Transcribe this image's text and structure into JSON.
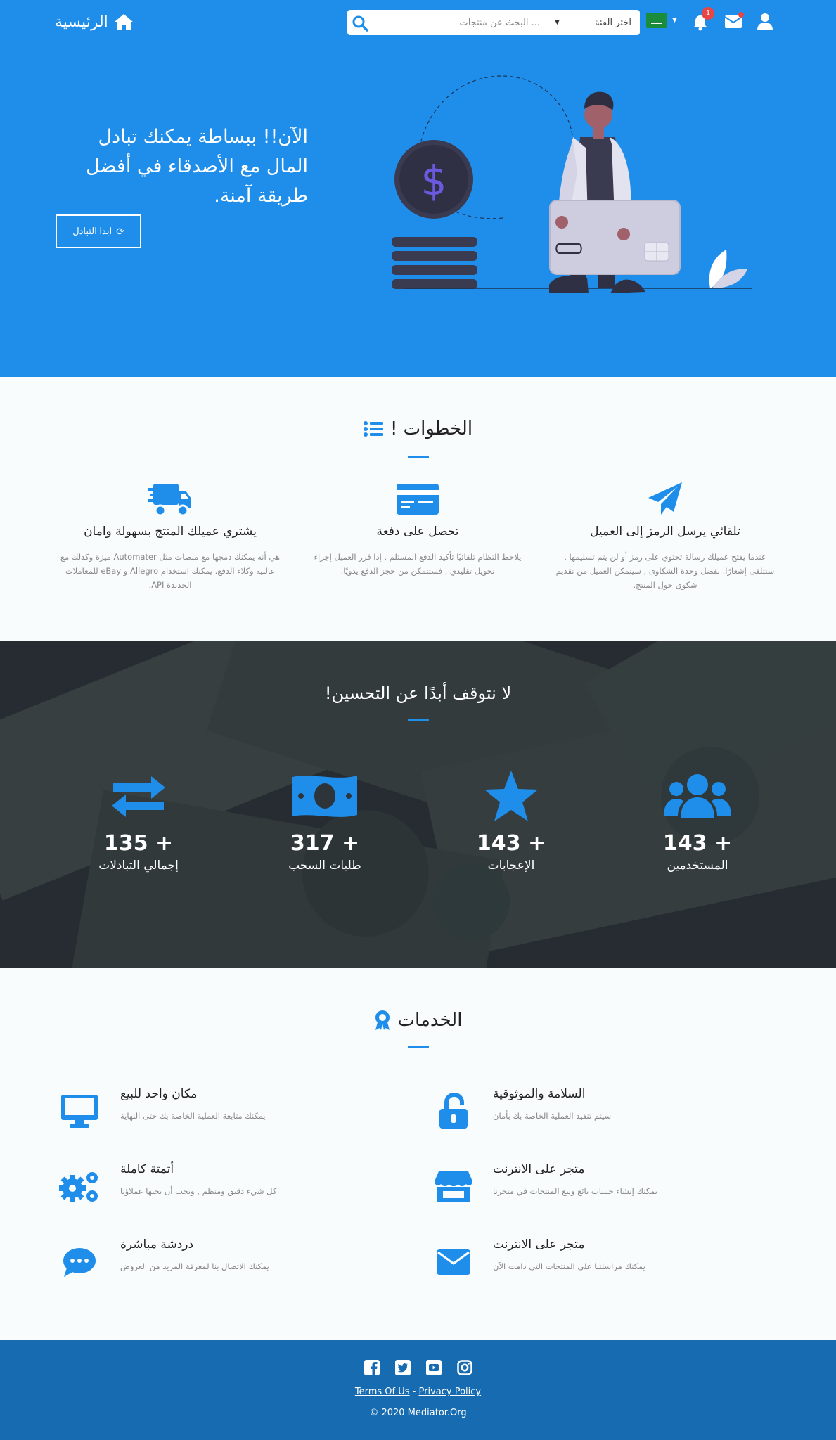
{
  "navbar": {
    "brand": "الرئيسية",
    "search_placeholder": "... البحث عن منتجات",
    "category_label": "اختر الفئة",
    "notification_count": "1"
  },
  "hero": {
    "title": "الآن!! ببساطة يمكنك تبادل المال مع الأصدقاء في أفضل طريقة آمنة.",
    "button_label": "ابدا التبادل"
  },
  "steps": {
    "title": "الخطوات !",
    "items": [
      {
        "title": "تلقائي يرسل الرمز إلى العميل",
        "text": "عندما يفتح عميلك رسالة تحتوي على رمز أو لن يتم تسليمها , ستتلقى إشعارًا. بفضل وحدة الشكاوى , سيتمكن العميل من تقديم شكوى حول المنتج.",
        "icon": "paper-plane-icon"
      },
      {
        "title": "تحصل على دفعة",
        "text": "يلاحظ النظام تلقائيًا تأكيد الدفع المستلم , إذا قرر العميل إجراء تحويل تقليدي , فستتمكن من حجز الدفع يدويًا.",
        "icon": "credit-card-icon"
      },
      {
        "title": "يشتري عميلك المنتج بسهولة وامان",
        "text": "هي أنه يمكنك دمجها مع منصات مثل Automater ميزة وكذلك مع عالبية وكلاء الدفع. يمكنك استخدام Allegro و eBay للمعاملات الجديدة API.",
        "icon": "truck-icon"
      }
    ]
  },
  "stats": {
    "title": "لا نتوقف أبدًا عن التحسين!",
    "items": [
      {
        "number": "143 +",
        "label": "المستخدمين",
        "icon": "users-icon"
      },
      {
        "number": "143 +",
        "label": "الإعجابات",
        "icon": "star-icon"
      },
      {
        "number": "317 +",
        "label": "طلبات السحب",
        "icon": "money-bill-icon"
      },
      {
        "number": "135 +",
        "label": "إجمالي التبادلات",
        "icon": "exchange-icon"
      }
    ]
  },
  "services": {
    "title": "الخدمات",
    "items": [
      {
        "title": "السلامة والموثوقية",
        "text": "سيتم تنفيذ العملية الخاصة بك بأمان",
        "icon": "unlock-icon"
      },
      {
        "title": "مكان واحد للبيع",
        "text": "يمكنك متابعة العملية الخاصة بك حتى النهاية",
        "icon": "desktop-icon"
      },
      {
        "title": "متجر على الانترنت",
        "text": "يمكنك إنشاء حساب بائع وبيع المنتجات في متجرنا",
        "icon": "store-icon"
      },
      {
        "title": "أتمتة كاملة",
        "text": "كل شيء دقيق ومنظم , ويجب أن يحبها عملاؤنا",
        "icon": "cogs-icon"
      },
      {
        "title": "متجر على الانترنت",
        "text": "يمكنك مراسلتنا على المنتجات التي دامت الآن",
        "icon": "envelope-icon"
      },
      {
        "title": "دردشة مباشرة",
        "text": "يمكنك الاتصال بنا لمعرفة المزيد من العروض",
        "icon": "chat-icon"
      }
    ]
  },
  "footer": {
    "terms": "Terms Of Us",
    "separator": "-",
    "privacy": "Privacy Policy",
    "copyright": "© 2020 Mediator.Org"
  },
  "colors": {
    "primary": "#1f8eea",
    "footer": "#176bb0",
    "badge": "#e84545"
  }
}
